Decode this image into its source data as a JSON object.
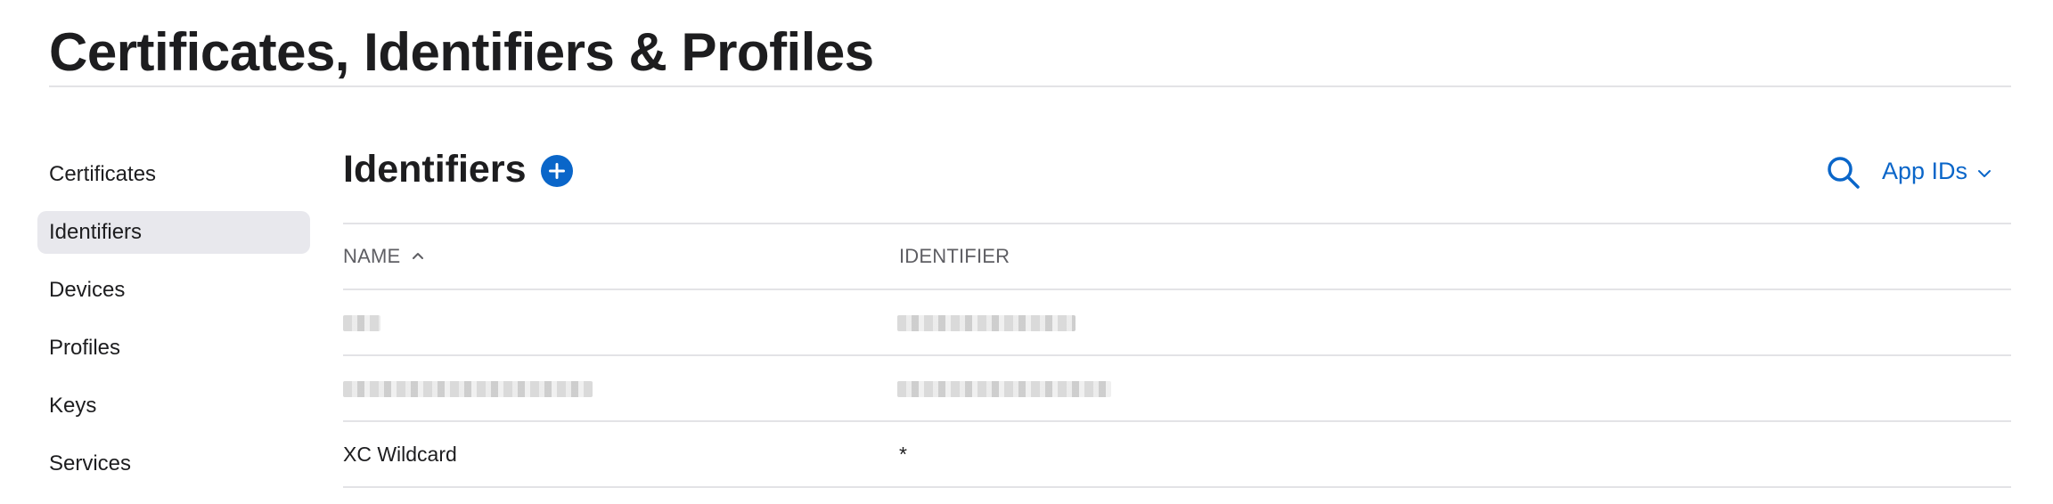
{
  "header": {
    "title": "Certificates, Identifiers & Profiles"
  },
  "sidebar": {
    "items": [
      {
        "label": "Certificates"
      },
      {
        "label": "Identifiers",
        "active": true
      },
      {
        "label": "Devices"
      },
      {
        "label": "Profiles"
      },
      {
        "label": "Keys"
      },
      {
        "label": "Services"
      }
    ]
  },
  "main": {
    "section_title": "Identifiers",
    "add_icon": "plus-circle-icon",
    "search_icon": "search-icon",
    "filter": {
      "label": "App IDs",
      "icon": "chevron-down-icon"
    },
    "table": {
      "columns": [
        "NAME",
        "IDENTIFIER"
      ],
      "sort_icon": "chevron-up-icon",
      "rows": [
        {
          "name": "",
          "identifier": "",
          "redacted": true
        },
        {
          "name": "",
          "identifier": "",
          "redacted": true
        },
        {
          "name": "XC Wildcard",
          "identifier": "*"
        }
      ]
    }
  },
  "colors": {
    "accent": "#0a66c9",
    "text": "#1d1d1f",
    "muted": "#5e5e63",
    "active_bg": "#e8e8ed",
    "divider": "#e3e3e6"
  }
}
